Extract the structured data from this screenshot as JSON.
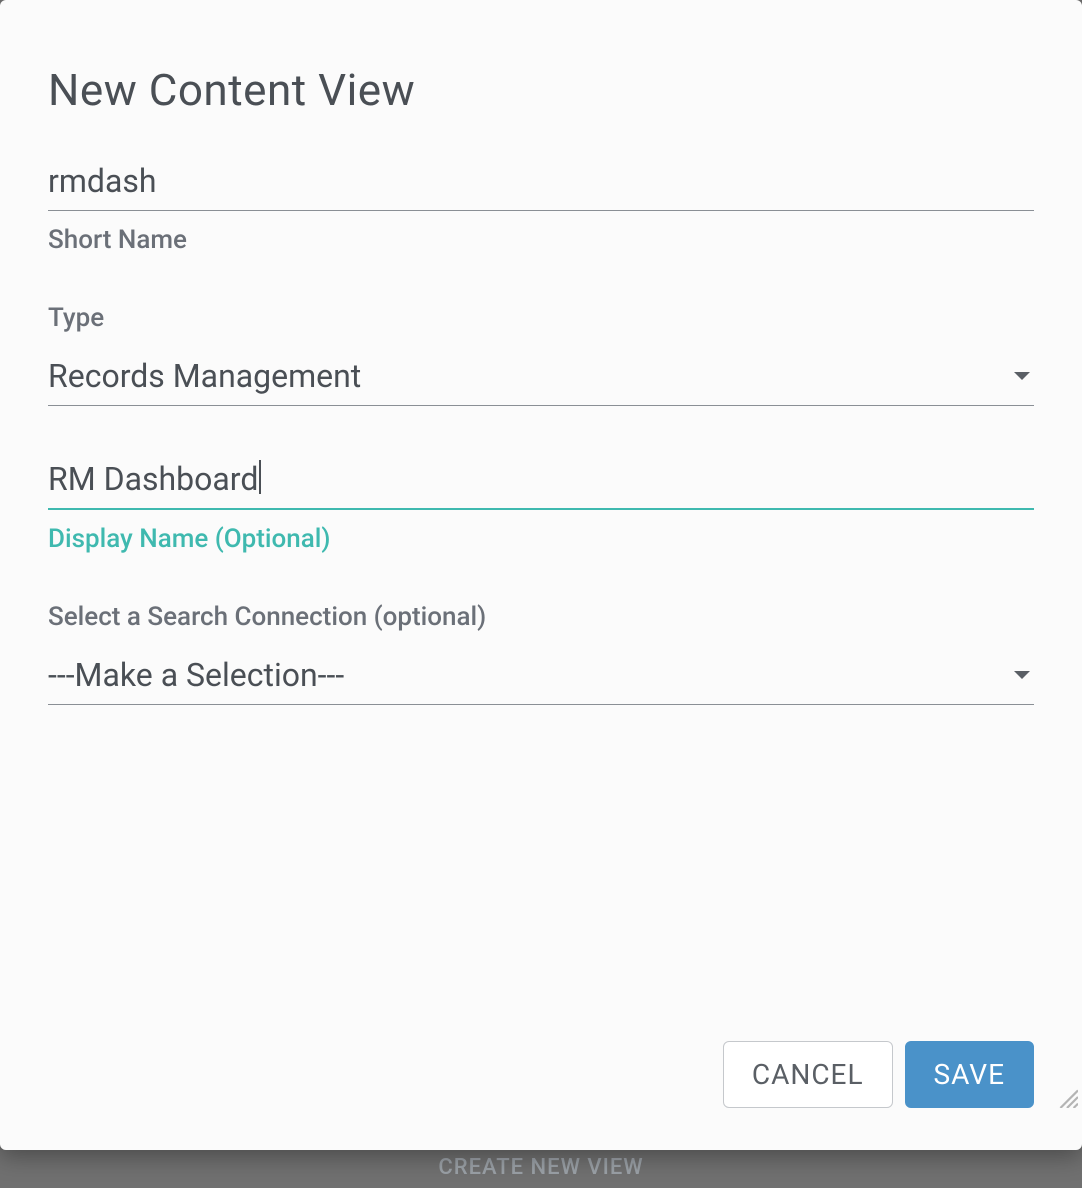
{
  "dialog": {
    "title": "New Content View",
    "shortName": {
      "value": "rmdash",
      "label": "Short Name"
    },
    "type": {
      "label": "Type",
      "value": "Records Management"
    },
    "displayName": {
      "value": "RM Dashboard",
      "label": "Display Name (Optional)"
    },
    "searchConnection": {
      "label": "Select a Search Connection (optional)",
      "value": "---Make a Selection---"
    },
    "buttons": {
      "cancel": "CANCEL",
      "save": "SAVE"
    }
  },
  "background": {
    "createButton": "CREATE NEW VIEW"
  }
}
